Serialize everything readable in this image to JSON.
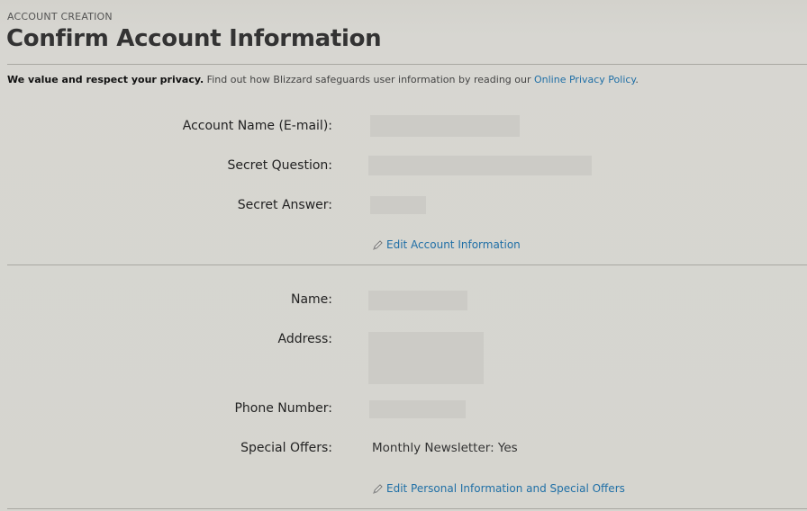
{
  "header": {
    "eyebrow": "ACCOUNT CREATION",
    "title": "Confirm Account Information"
  },
  "privacy": {
    "bold": "We value and respect your privacy.",
    "text": " Find out how Blizzard safeguards user information by reading our ",
    "link": "Online Privacy Policy",
    "end": "."
  },
  "account": {
    "account_name_label": "Account Name (E-mail):",
    "secret_question_label": "Secret Question:",
    "secret_answer_label": "Secret Answer:",
    "edit_link": "Edit Account Information"
  },
  "personal": {
    "name_label": "Name:",
    "address_label": "Address:",
    "phone_label": "Phone Number:",
    "offers_label": "Special Offers:",
    "offers_value": "Monthly Newsletter: Yes",
    "edit_link": "Edit Personal Information and Special Offers"
  },
  "icons": {
    "edit": "pencil-icon"
  },
  "colors": {
    "link": "#1f6fa6",
    "background": "#d6d5cf"
  }
}
